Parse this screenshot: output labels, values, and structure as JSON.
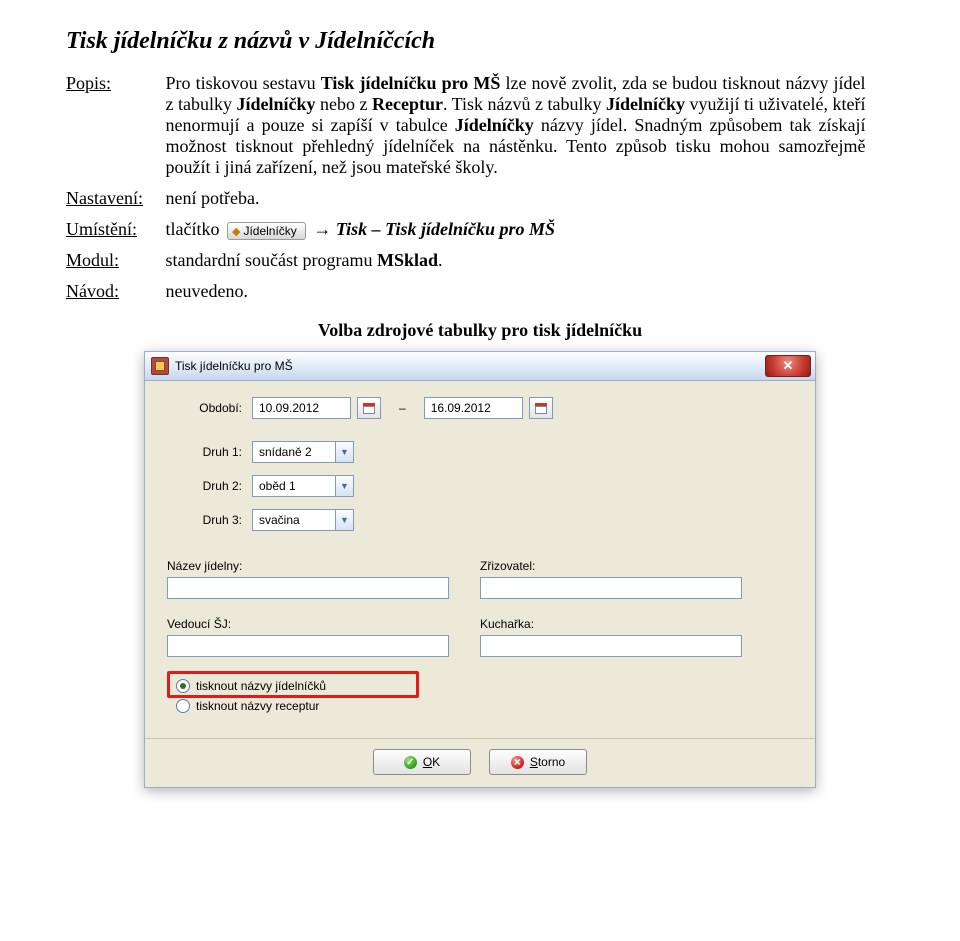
{
  "title": "Tisk jídelníčku z názvů v Jídelníčcích",
  "rows": {
    "popis": {
      "label": "Popis:",
      "p1a": "Pro tiskovou sestavu ",
      "p1b": "Tisk jídelníčku pro MŠ",
      "p1c": " lze nově zvolit, zda se budou tisknout názvy jídel z tabulky ",
      "p1d": "Jídelníčky",
      "p1e": " nebo z ",
      "p1f": "Receptur",
      "p1g": ". Tisk názvů z tabulky ",
      "p1h": "Jídelníčky",
      "p1i": " využijí ti uživatelé, kteří nenormují a pouze si zapíší v tabulce ",
      "p1j": "Jídelníčky",
      "p1k": " názvy jídel. Snadným způsobem tak získají možnost tisknout přehledný jídelníček na nástěnku. Tento způsob tisku mohou samozřejmě použít i jiná zařízení, než jsou mateřské školy."
    },
    "nastaveni": {
      "label": "Nastavení:",
      "value": "není potřeba."
    },
    "umisteni": {
      "label": "Umístění:",
      "pre": "tlačítko",
      "btn": "Jídelníčky",
      "post": " → Tisk – Tisk jídelníčku pro MŠ"
    },
    "modul": {
      "label": "Modul:",
      "a": "standardní součást programu ",
      "b": "MSklad",
      "c": "."
    },
    "navod": {
      "label": "Návod:",
      "value": "neuvedeno."
    }
  },
  "caption": "Volba zdrojové tabulky pro tisk jídelníčku",
  "dialog": {
    "title": "Tisk jídelníčku pro MŠ",
    "period_label": "Období:",
    "date_from": "10.09.2012",
    "dash": "–",
    "date_to": "16.09.2012",
    "druh1_label": "Druh 1:",
    "druh1": "snídaně 2",
    "druh2_label": "Druh 2:",
    "druh2": "oběd 1",
    "druh3_label": "Druh 3:",
    "druh3": "svačina",
    "nazev_label": "Název jídelny:",
    "zriz_label": "Zřizovatel:",
    "vedouci_label": "Vedoucí ŠJ:",
    "kucharka_label": "Kuchařka:",
    "radio1": "tisknout názvy jídelníčků",
    "radio2": "tisknout názvy receptur",
    "ok_u": "O",
    "ok_r": "K",
    "storno_u": "S",
    "storno_r": "torno"
  }
}
